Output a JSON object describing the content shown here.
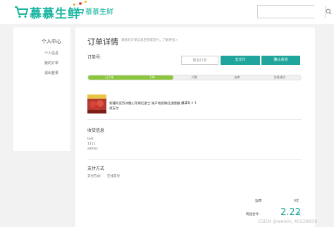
{
  "brand": {
    "name": "慕慕生鲜",
    "small_name": "慕慕生鲜",
    "accent": "#17b5a0"
  },
  "search": {
    "placeholder": "",
    "icon": "search-icon"
  },
  "sidebar": {
    "title": "个人中心",
    "items": [
      {
        "label": "个人信息"
      },
      {
        "label": "我的订单"
      },
      {
        "label": "退出登录"
      }
    ]
  },
  "order": {
    "title": "订单详情",
    "note": "请核对订单信息后完成支付，了解更多>",
    "number_label": "订单号:",
    "number": "",
    "buttons": {
      "cancel": "取消订单",
      "pay": "去支付",
      "confirm": "确认收货"
    },
    "steps": [
      {
        "label": "已下单",
        "done": true
      },
      {
        "label": "下单",
        "done": true
      },
      {
        "label": "付款",
        "done": false
      },
      {
        "label": "出库",
        "done": false
      },
      {
        "label": "交易成功",
        "done": false
      }
    ],
    "progress_fraction": 0.4,
    "product": {
      "name": "新疆阿克苏冰糖心苹果红富士 果产地新鲜红透嘎嘣 原子 5",
      "price": "2.22",
      "quantity": "× 1",
      "status": "待支付"
    },
    "shipping": {
      "title": "收货信息",
      "name": "test",
      "phone": "1111",
      "address": "admss"
    },
    "payment": {
      "title": "支付方式",
      "method_label": "支付方式:",
      "method_value": "在线支付"
    },
    "summary": {
      "total_label": "运费:",
      "total_value": "0元",
      "pay_label": "商品合计:",
      "pay_value": "2.22",
      "pay_unit": "元"
    }
  },
  "watermark": "CSDN @weixin_40228600"
}
